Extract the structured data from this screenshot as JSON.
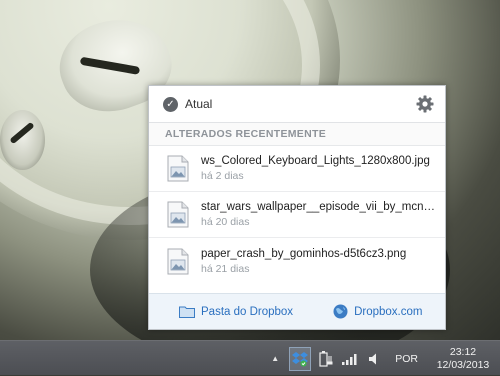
{
  "popup": {
    "status_label": "Atual",
    "section_title": "ALTERADOS RECENTEMENTE",
    "files": [
      {
        "name": "ws_Colored_Keyboard_Lights_1280x800.jpg",
        "time": "há 2 dias"
      },
      {
        "name": "star_wars_wallpaper__episode_vii_by_mcneal...",
        "time": "há 20 dias"
      },
      {
        "name": "paper_crash_by_gominhos-d5t6cz3.png",
        "time": "há 21 dias"
      }
    ],
    "footer": {
      "folder_link": "Pasta do Dropbox",
      "web_link": "Dropbox.com"
    }
  },
  "taskbar": {
    "language": "POR",
    "time": "23:12",
    "date": "12/03/2013"
  },
  "colors": {
    "link": "#2a6fbf",
    "footer_bg": "#eef4fa",
    "taskbar": "#55575c"
  },
  "icons": [
    "check-circle-icon",
    "gear-icon",
    "image-file-icon",
    "folder-icon",
    "globe-icon",
    "tray-expand-icon",
    "dropbox-tray-icon",
    "power-icon",
    "signal-icon",
    "volume-icon"
  ]
}
